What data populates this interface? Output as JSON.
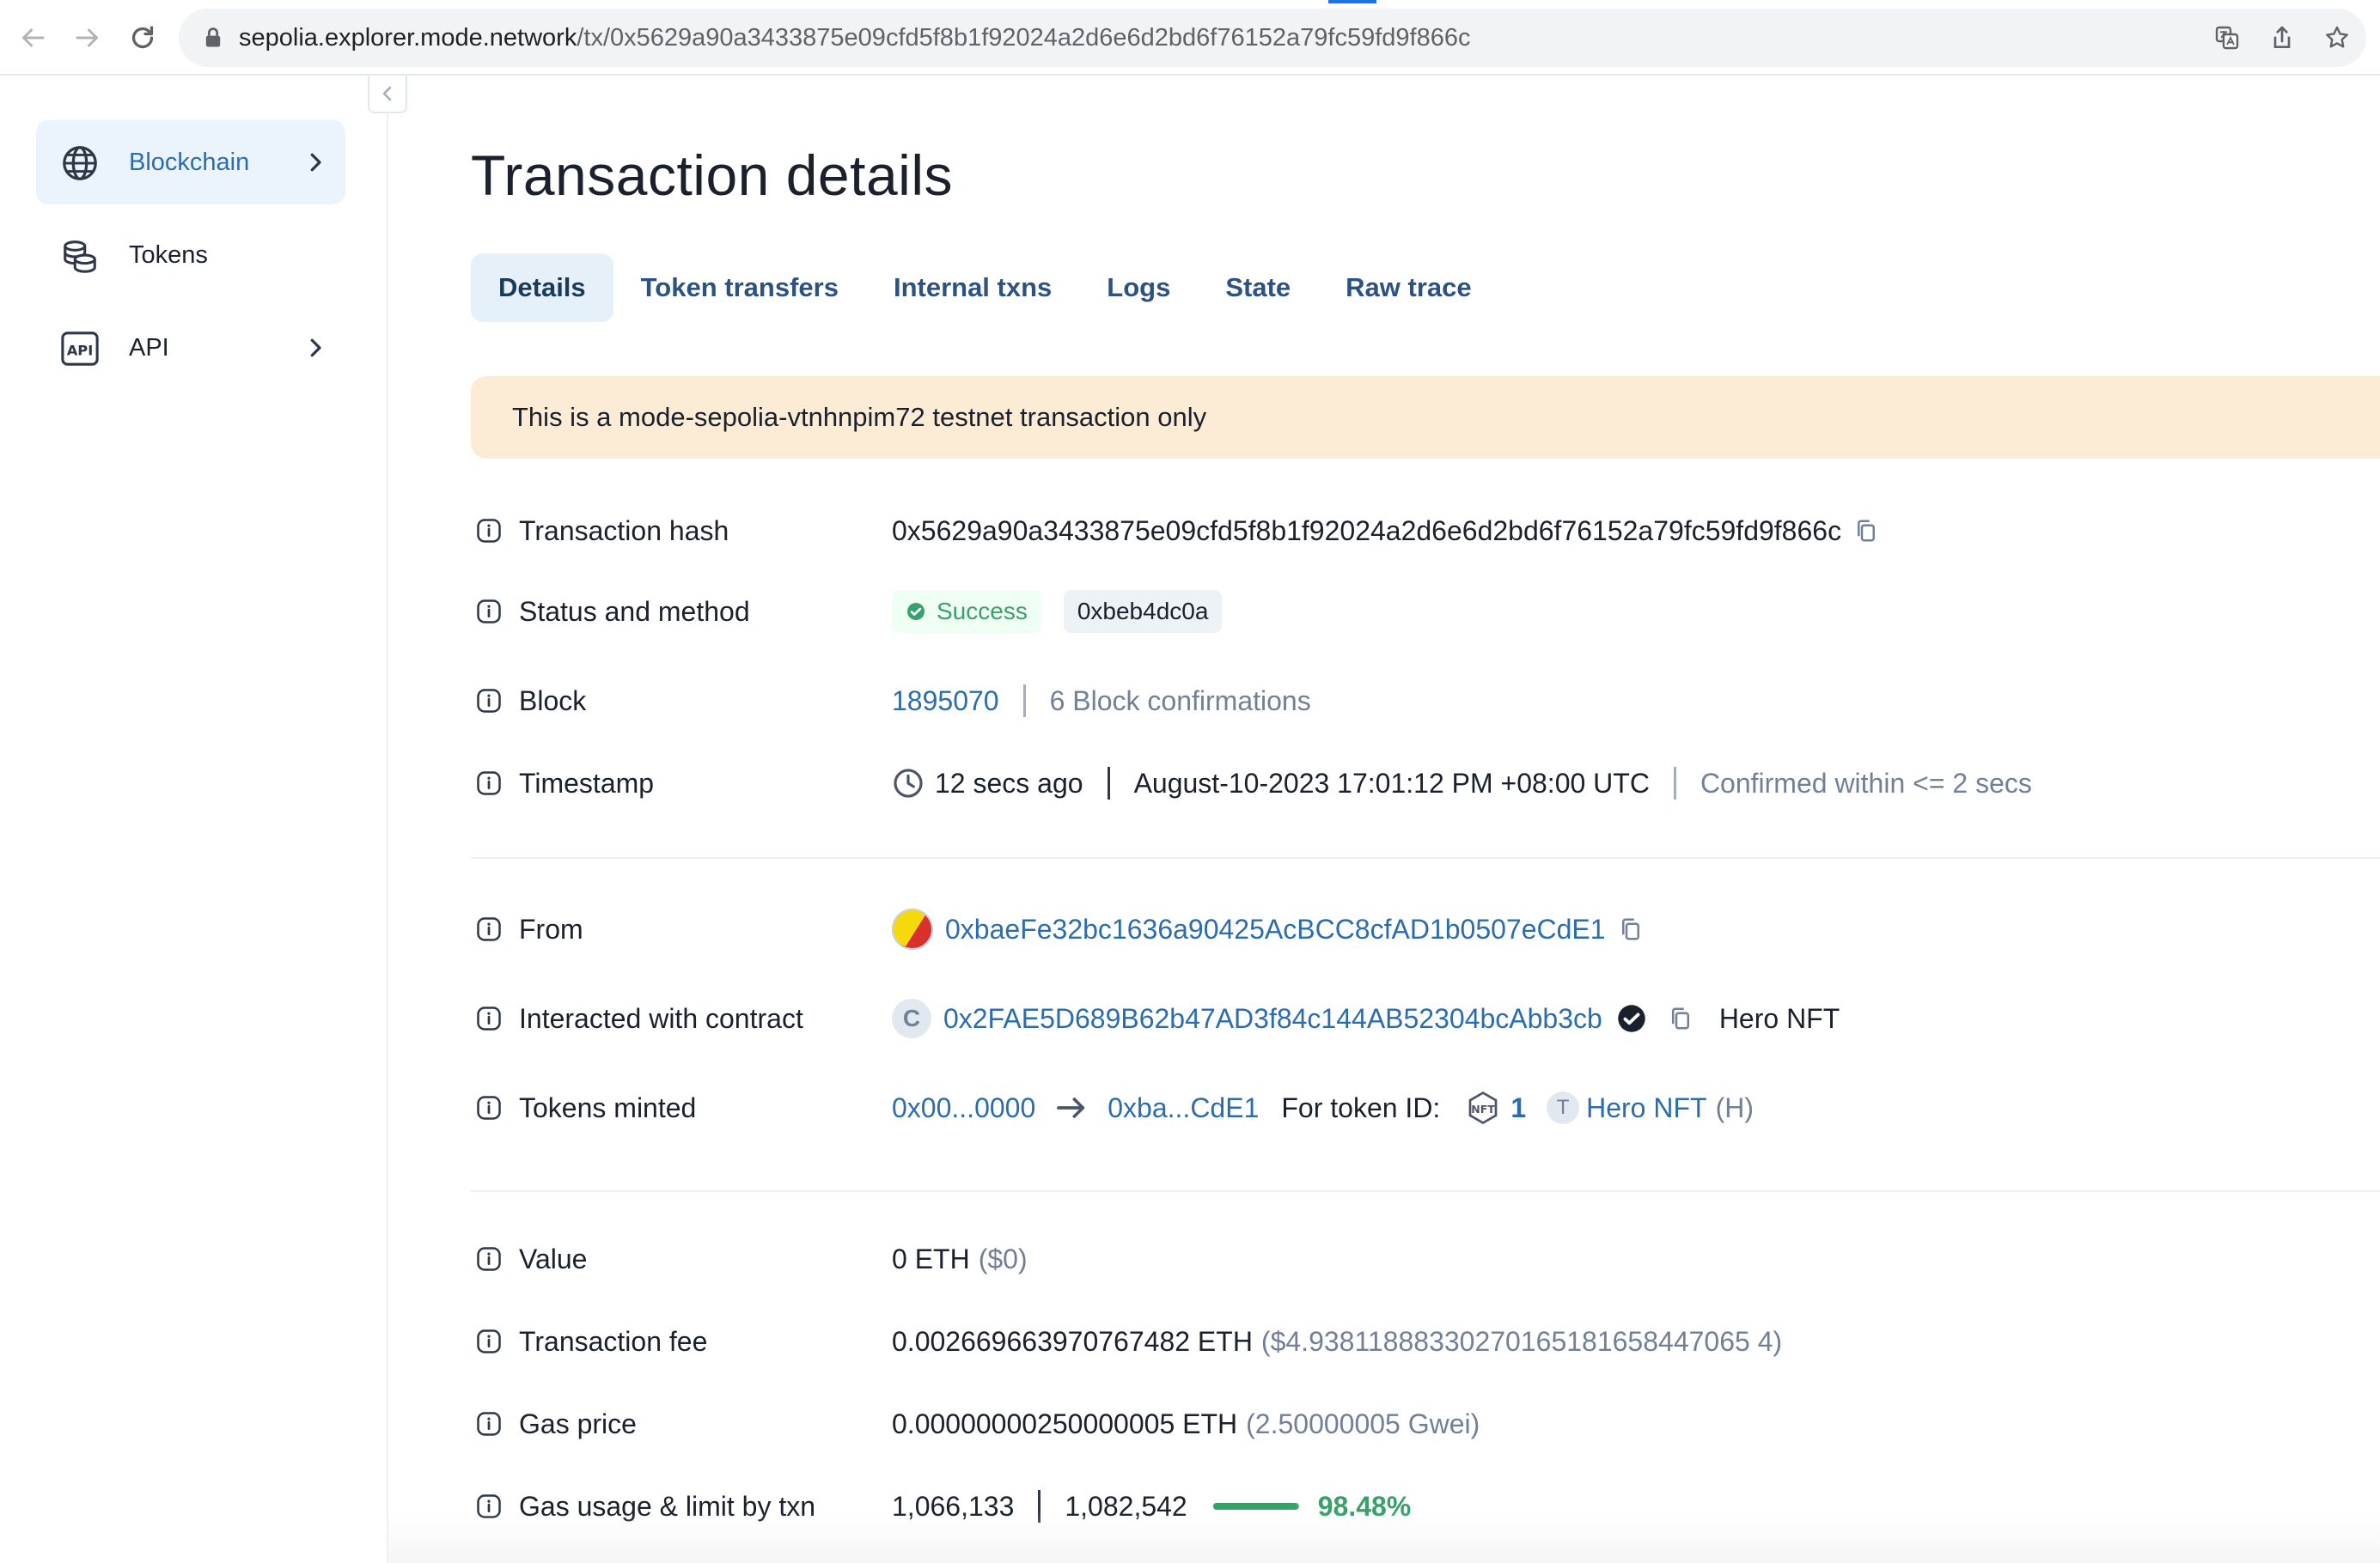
{
  "browser": {
    "url_host": "sepolia.explorer.mode.network",
    "url_path": "/tx/0x5629a90a3433875e09cfd5f8b1f92024a2d6e6d2bd6f76152a79fc59fd9f866c"
  },
  "sidebar": {
    "items": [
      {
        "label": "Blockchain",
        "icon": "globe-icon",
        "has_chevron": true,
        "active": true
      },
      {
        "label": "Tokens",
        "icon": "coins-icon",
        "has_chevron": false,
        "active": false
      },
      {
        "label": "API",
        "icon": "api-icon",
        "has_chevron": true,
        "active": false
      }
    ]
  },
  "page": {
    "title": "Transaction details",
    "tabs": [
      "Details",
      "Token transfers",
      "Internal txns",
      "Logs",
      "State",
      "Raw trace"
    ],
    "active_tab": "Details",
    "banner": "This is a mode-sepolia-vtnhnpim72 testnet transaction only"
  },
  "details": {
    "tx_hash": {
      "label": "Transaction hash",
      "value": "0x5629a90a3433875e09cfd5f8b1f92024a2d6e6d2bd6f76152a79fc59fd9f866c"
    },
    "status": {
      "label": "Status and method",
      "status": "Success",
      "method": "0xbeb4dc0a"
    },
    "block": {
      "label": "Block",
      "number": "1895070",
      "confirmations": "6 Block confirmations"
    },
    "timestamp": {
      "label": "Timestamp",
      "ago": "12 secs ago",
      "datetime": "August-10-2023 17:01:12 PM +08:00 UTC",
      "confirmed": "Confirmed within <= 2 secs"
    },
    "from": {
      "label": "From",
      "address": "0xbaeFe32bc1636a90425AcBCC8cfAD1b0507eCdE1"
    },
    "contract": {
      "label": "Interacted with contract",
      "avatar_letter": "C",
      "address": "0x2FAE5D689B62b47AD3f84c144AB52304bcAbb3cb",
      "name": "Hero NFT"
    },
    "tokens_minted": {
      "label": "Tokens minted",
      "from": "0x00...0000",
      "to": "0xba...CdE1",
      "for_label": "For token ID:",
      "token_id": "1",
      "token_avatar": "T",
      "token_name": "Hero NFT",
      "token_symbol": "(H)"
    },
    "value": {
      "label": "Value",
      "amount": "0 ETH",
      "usd": "($0)"
    },
    "fee": {
      "label": "Transaction fee",
      "amount": "0.002669663970767482 ETH",
      "usd": "($4.93811888330270165181658447065 4)"
    },
    "gas_price": {
      "label": "Gas price",
      "amount": "0.00000000250000005 ETH",
      "gwei": "(2.50000005 Gwei)"
    },
    "gas_usage": {
      "label": "Gas usage & limit by txn",
      "used": "1,066,133",
      "limit": "1,082,542",
      "percent": "98.48%",
      "fraction": 0.9848
    }
  },
  "colors": {
    "accent": "#2b6cb0",
    "success": "#38a169",
    "banner": "#fcecd5",
    "active_bg": "#ebf4fc"
  }
}
